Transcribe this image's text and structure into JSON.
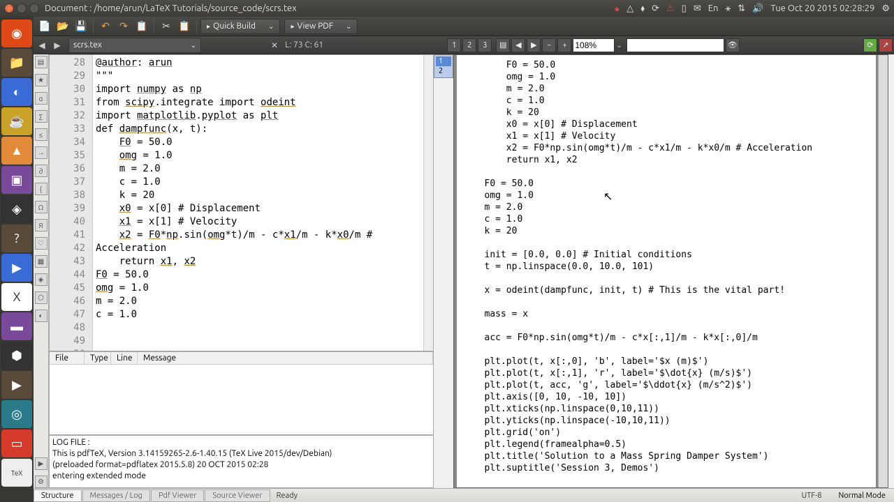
{
  "window": {
    "title": "Document : /home/arun/LaTeX Tutorials/source_code/scrs.tex"
  },
  "top_icons": {
    "lang": "En",
    "clock": "Tue Oct 20 2015 02:28:29"
  },
  "toolbar": {
    "quickbuild": "Quick Build",
    "viewpdf": "View PDF"
  },
  "tabbar": {
    "file": "scrs.tex",
    "cursor": "L: 73 C: 61",
    "zoom": "108%"
  },
  "minitab": {
    "p1": "1",
    "p2": "2"
  },
  "gutter_start": 28,
  "code_lines": [
    "@author: arun",
    "\"\"\"",
    "",
    "import numpy as np",
    "from scipy.integrate import odeint",
    "import matplotlib.pyplot as plt",
    "",
    "def dampfunc(x, t):",
    "    F0 = 50.0",
    "    omg = 1.0",
    "    m = 2.0",
    "    c = 1.0",
    "    k = 20",
    "    x0 = x[0] # Displacement",
    "    x1 = x[1] # Velocity",
    "    x2 = F0*np.sin(omg*t)/m - c*x1/m - k*x0/m #",
    "Acceleration",
    "    return x1, x2",
    "",
    "F0 = 50.0",
    "omg = 1.0",
    "m = 2.0",
    "c = 1.0"
  ],
  "pdf_lines": [
    "    F0 = 50.0",
    "    omg = 1.0",
    "    m = 2.0",
    "    c = 1.0",
    "    k = 20",
    "    x0 = x[0] # Displacement",
    "    x1 = x[1] # Velocity",
    "    x2 = F0*np.sin(omg*t)/m - c*x1/m - k*x0/m # Acceleration",
    "    return x1, x2",
    "",
    "F0 = 50.0",
    "omg = 1.0",
    "m = 2.0",
    "c = 1.0",
    "k = 20",
    "",
    "init = [0.0, 0.0] # Initial conditions",
    "t = np.linspace(0.0, 10.0, 101)",
    "",
    "x = odeint(dampfunc, init, t) # This is the vital part!",
    "",
    "mass = x",
    "",
    "acc = F0*np.sin(omg*t)/m - c*x[:,1]/m - k*x[:,0]/m",
    "",
    "plt.plot(t, x[:,0], 'b', label='$x (m)$')",
    "plt.plot(t, x[:,1], 'r', label='$\\dot{x} (m/s)$')",
    "plt.plot(t, acc, 'g', label='$\\ddot{x} (m/s^2)$')",
    "plt.axis([0, 10, -10, 10])",
    "plt.xticks(np.linspace(0,10,11))",
    "plt.yticks(np.linspace(-10,10,11))",
    "plt.grid('on')",
    "plt.legend(framealpha=0.5)",
    "plt.title('Solution to a Mass Spring Damper System')",
    "plt.suptitle('Session 3, Demos')"
  ],
  "msg": {
    "file": "File",
    "type": "Type",
    "line": "Line",
    "message": "Message"
  },
  "log": {
    "hdr": "LOG FILE :",
    "l1": "This is pdfTeX, Version 3.14159265-2.6-1.40.15 (TeX Live 2015/dev/Debian)",
    "l2": "(preloaded format=pdflatex 2015.5.8) 20 OCT 2015 02:28",
    "l3": "entering extended mode"
  },
  "bottom": {
    "t1": "Structure",
    "t2": "Messages / Log",
    "t3": "Pdf Viewer",
    "t4": "Source Viewer",
    "status": "Ready",
    "enc": "UTF-8",
    "mode": "Normal Mode"
  }
}
